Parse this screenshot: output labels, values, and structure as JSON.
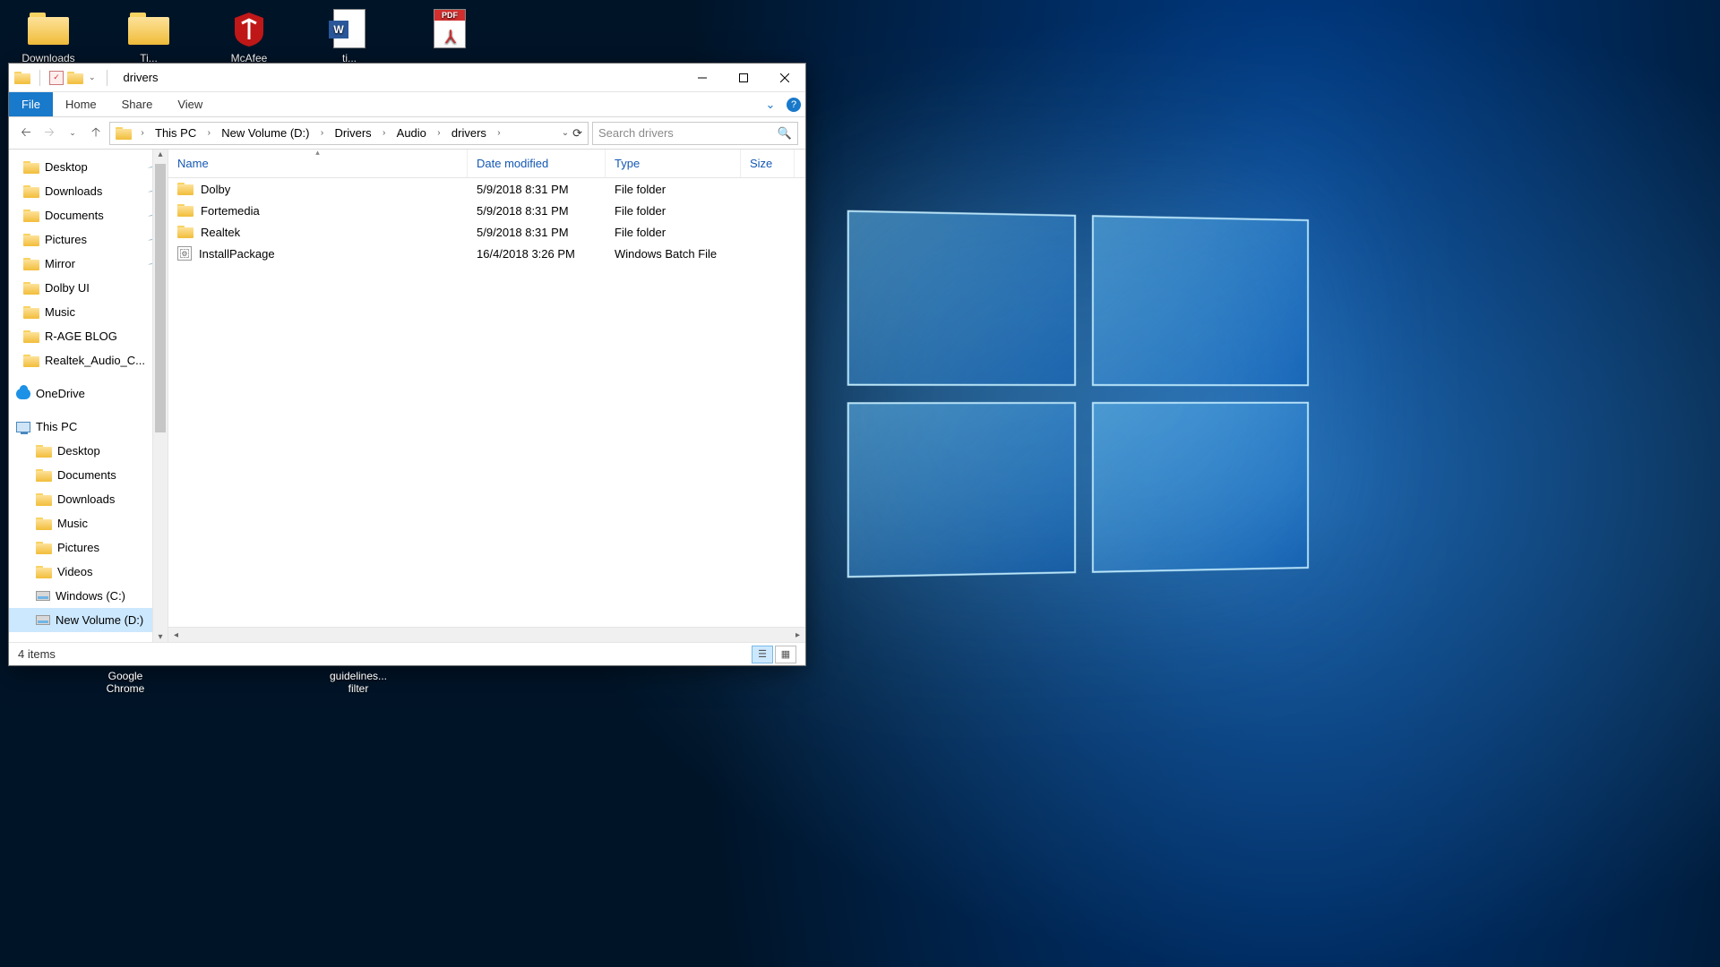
{
  "desktop_icons": [
    {
      "label": "Downloads",
      "glyph": "folder"
    },
    {
      "label": "Ti...",
      "glyph": "folder"
    },
    {
      "label": "McAfee",
      "glyph": "mcafee"
    },
    {
      "label": "ti...",
      "glyph": "word"
    },
    {
      "label": "",
      "glyph": "pdf"
    }
  ],
  "taskbar_remnants": [
    "Google Chrome",
    "",
    "guidelines... filter"
  ],
  "window": {
    "title": "drivers",
    "ribbon": {
      "file": "File",
      "home": "Home",
      "share": "Share",
      "view": "View"
    },
    "breadcrumb": [
      "This PC",
      "New Volume (D:)",
      "Drivers",
      "Audio",
      "drivers"
    ],
    "search_placeholder": "Search drivers",
    "columns": {
      "name": "Name",
      "date": "Date modified",
      "type": "Type",
      "size": "Size"
    },
    "items": [
      {
        "icon": "folder",
        "name": "Dolby",
        "date": "5/9/2018 8:31 PM",
        "type": "File folder",
        "size": ""
      },
      {
        "icon": "folder",
        "name": "Fortemedia",
        "date": "5/9/2018 8:31 PM",
        "type": "File folder",
        "size": ""
      },
      {
        "icon": "folder",
        "name": "Realtek",
        "date": "5/9/2018 8:31 PM",
        "type": "File folder",
        "size": ""
      },
      {
        "icon": "batch",
        "name": "InstallPackage",
        "date": "16/4/2018 3:26 PM",
        "type": "Windows Batch File",
        "size": ""
      }
    ],
    "status": "4 items",
    "navpane": {
      "quick": [
        {
          "label": "Desktop",
          "pin": true
        },
        {
          "label": "Downloads",
          "pin": true
        },
        {
          "label": "Documents",
          "pin": true
        },
        {
          "label": "Pictures",
          "pin": true
        },
        {
          "label": "Mirror",
          "pin": true
        },
        {
          "label": "Dolby UI",
          "pin": false
        },
        {
          "label": "Music",
          "pin": false
        },
        {
          "label": "R-AGE BLOG",
          "pin": false
        },
        {
          "label": "Realtek_Audio_C...",
          "pin": false
        }
      ],
      "onedrive": "OneDrive",
      "thispc": "This PC",
      "thispc_children": [
        "Desktop",
        "Documents",
        "Downloads",
        "Music",
        "Pictures",
        "Videos",
        "Windows (C:)",
        "New Volume (D:)"
      ]
    }
  }
}
